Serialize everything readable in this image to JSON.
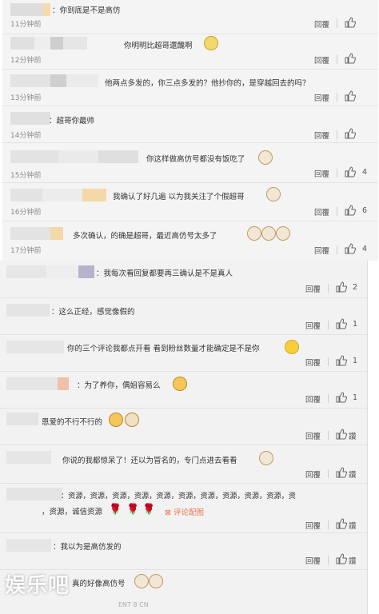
{
  "top_comments": [
    {
      "text": "：你到底是不是高仿",
      "time": "11分钟前",
      "reply": "回覆",
      "likes": ""
    },
    {
      "text": "你明明比超哥還醜啊",
      "time": "12分钟前",
      "reply": "回覆",
      "likes": ""
    },
    {
      "text": "他两点多发的，你三点多发的？他抄你的，是穿越回去的吗？",
      "time": "13分钟前",
      "reply": "回覆",
      "likes": ""
    },
    {
      "text": "：超哥你最帅",
      "time": "14分钟前",
      "reply": "回覆",
      "likes": ""
    },
    {
      "text": "你这样做高仿号都没有饭吃了",
      "time": "15分钟前",
      "reply": "回覆",
      "likes": "4"
    },
    {
      "text": "我确认了好几遍 以为我关注了个假超哥",
      "time": "16分钟前",
      "reply": "回覆",
      "likes": "6"
    },
    {
      "text": "多次确认，的确是超哥，最近高仿号太多了",
      "time": "17分钟前",
      "reply": "回覆",
      "likes": "4"
    }
  ],
  "bottom_comments": [
    {
      "text": "：我每次看回复都要再三确认是不是真人",
      "reply": "回覆",
      "likes": "2"
    },
    {
      "text": "：这么正经，感觉像假的",
      "reply": "回覆",
      "likes": "1"
    },
    {
      "text": "你的三个评论我都点开看 看到粉丝数量才能确定是不是你",
      "reply": "回覆",
      "likes": "1"
    },
    {
      "text": "：为了养你，偶姐容易么",
      "reply": "回覆",
      "likes": "1"
    },
    {
      "text": "恩爱的不行不行的",
      "reply": "回覆",
      "likes": "讚"
    },
    {
      "text": "你说的我都惊呆了！还以为冒名的，专门点进去看看",
      "reply": "回覆",
      "likes": "讚"
    },
    {
      "text": "：资源，资源，资源，资源，资源，资源，资源，资源，资源，资源，资",
      "text2": "，资源，诚信资源",
      "link": "评论配图",
      "reply": "回覆",
      "likes": "讚"
    },
    {
      "text": "：我以为是高仿发的",
      "reply": "回覆",
      "likes": "讚"
    },
    {
      "text": "真的好像高仿号",
      "reply": "",
      "likes": ""
    }
  ],
  "watermark": {
    "main": "娱乐吧",
    "sub": "ENT 8 CN"
  }
}
